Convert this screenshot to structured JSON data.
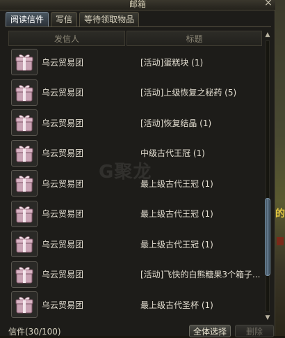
{
  "window": {
    "title": "邮箱",
    "close_glyph": "×"
  },
  "tabs": [
    {
      "label": "阅读信件",
      "active": true
    },
    {
      "label": "写信",
      "active": false
    },
    {
      "label": "等待领取物品",
      "active": false
    }
  ],
  "columns": {
    "sender": "发信人",
    "subject": "标题"
  },
  "mails": [
    {
      "icon": "gift-box-icon",
      "sender": "乌云贸易团",
      "subject": "[活动]蛋糕块 (1)"
    },
    {
      "icon": "gift-box-icon",
      "sender": "乌云贸易团",
      "subject": "[活动]上级恢复之秘药 (5)"
    },
    {
      "icon": "gift-box-icon",
      "sender": "乌云贸易团",
      "subject": "[活动]恢复结晶 (1)"
    },
    {
      "icon": "gift-box-icon",
      "sender": "乌云贸易团",
      "subject": "中级古代王冠 (1)"
    },
    {
      "icon": "gift-box-icon",
      "sender": "乌云贸易团",
      "subject": "最上级古代王冠 (1)"
    },
    {
      "icon": "gift-box-icon",
      "sender": "乌云贸易团",
      "subject": "最上级古代王冠 (1)"
    },
    {
      "icon": "gift-box-icon",
      "sender": "乌云贸易团",
      "subject": "最上级古代王冠 (1)"
    },
    {
      "icon": "gift-box-icon",
      "sender": "乌云贸易团",
      "subject": "[活动]飞快的白熊糖果3个箱子..."
    },
    {
      "icon": "gift-box-icon",
      "sender": "乌云贸易团",
      "subject": "最上级古代圣杯 (1)"
    }
  ],
  "footer": {
    "count": "信件(30/100)",
    "select_all": "全体选择",
    "delete": "删除"
  },
  "watermark": "G聚龙",
  "world_glyph": "的",
  "colors": {
    "gift_pink": "#c9a3b4",
    "gift_ribbon": "#f4e6ec",
    "thumb": "#6b8296"
  }
}
